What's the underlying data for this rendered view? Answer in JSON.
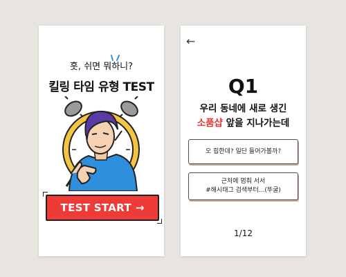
{
  "intro": {
    "subtitle": "훗, 쉬면 뭐하니?",
    "title": "킬링 타임 유형 TEST",
    "start_button": "TEST START",
    "start_arrow": "→"
  },
  "question": {
    "back_icon": "←",
    "number": "Q1",
    "line1": "우리 동네에 새로 생긴",
    "highlight": "소품샵",
    "line2_rest": " 앞을 지나가는데",
    "answers": [
      {
        "line1": "오 힙한데? 일단 들어가볼까?",
        "line2": ""
      },
      {
        "line1": "근처에 멈춰 서서",
        "line2": "#해시태그 검색부터...(뚜굴)"
      }
    ],
    "progress": "1/12"
  },
  "colors": {
    "background": "#e8e5e0",
    "accent_red": "#ee3b38",
    "clock_yellow": "#f5c443",
    "shirt_blue": "#2f8fdc",
    "hair_purple": "#5b3aa8"
  }
}
